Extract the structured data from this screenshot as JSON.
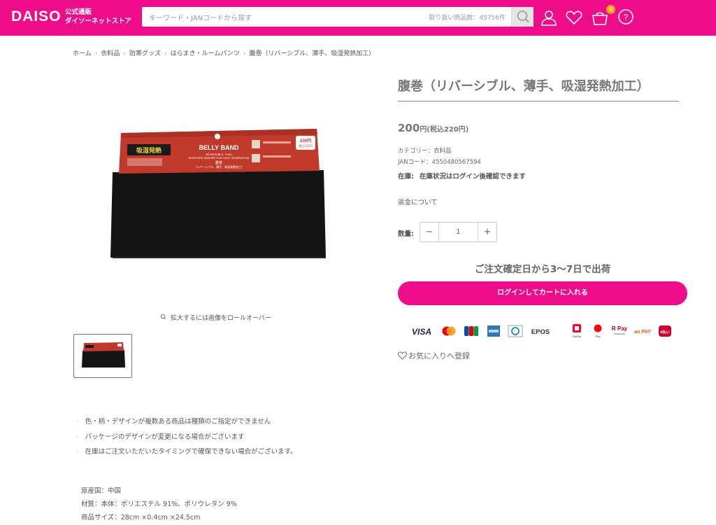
{
  "header": {
    "logo": "DAISO",
    "logo_sub_1": "公式通販",
    "logo_sub_2": "ダイソーネットストア",
    "search_placeholder": "キーワード・JANコードから探す",
    "search_count": "取り扱い商品数：45756件",
    "cart_count": "0",
    "colors": {
      "brand": "#ef0c8a",
      "badge": "#f4a21b"
    },
    "icons": [
      "search-icon",
      "user-icon",
      "heart-icon",
      "cart-icon",
      "help-icon"
    ]
  },
  "breadcrumb": [
    "ホーム",
    "衣料品",
    "防寒グッズ",
    "はらまき・ルームパンツ",
    "腹巻（リバーシブル、薄手、吸湿発熱加工）"
  ],
  "gallery": {
    "zoom_hint": "拡大するには画像をロールオーバー",
    "package_title": "BELLY BAND",
    "package_sub_1": "REVERSIBLE, THIN,",
    "package_sub_2": "MOISTURE ABSORPTION HEAT GENERATION",
    "package_jp_1": "腹巻",
    "package_jp_2": "（リバーシブル、薄手、吸湿発熱加工）",
    "package_feature": "吸湿発熱",
    "package_price_1": "200円",
    "package_price_2": "税込220円"
  },
  "product": {
    "title": "腹巻（リバーシブル、薄手、吸湿発熱加工）",
    "price": "200",
    "price_suffix": "円(税込220円)",
    "category": "カテゴリー：衣料品",
    "jan": "JANコード：4550480567594",
    "stock_label": "在庫:",
    "stock_value": "在庫状況はログイン後確認できます",
    "refund": "返金について",
    "qty_label": "数量:",
    "qty_value": "1",
    "minus": "−",
    "plus": "+",
    "shipping": "ご注文確定日から3〜7日で出荷",
    "cart_button": "ログインしてカートに入れる",
    "favorite": "お気に入りへ登録"
  },
  "payment": {
    "visa": "VISA",
    "epos": "EPOS",
    "paypay_1": "PayPay",
    "paypay_2": "Pay",
    "rpay": "R Pay",
    "aupay": "au PAY",
    "dbarai": "d払い"
  },
  "notes": [
    "色・柄・デザインが複数ある商品は種類のご指定ができません",
    "パッケージのデザインが変更になる場合がございます",
    "在庫はご注文いただいたタイミングで確保できない場合がございます。"
  ],
  "specs": {
    "origin": "原産国：中国",
    "material": "材質：本体：ポリエステル 91%、ポリウレタン 9%",
    "size": "商品サイズ：28cm ×0.4cm ×24.5cm"
  }
}
